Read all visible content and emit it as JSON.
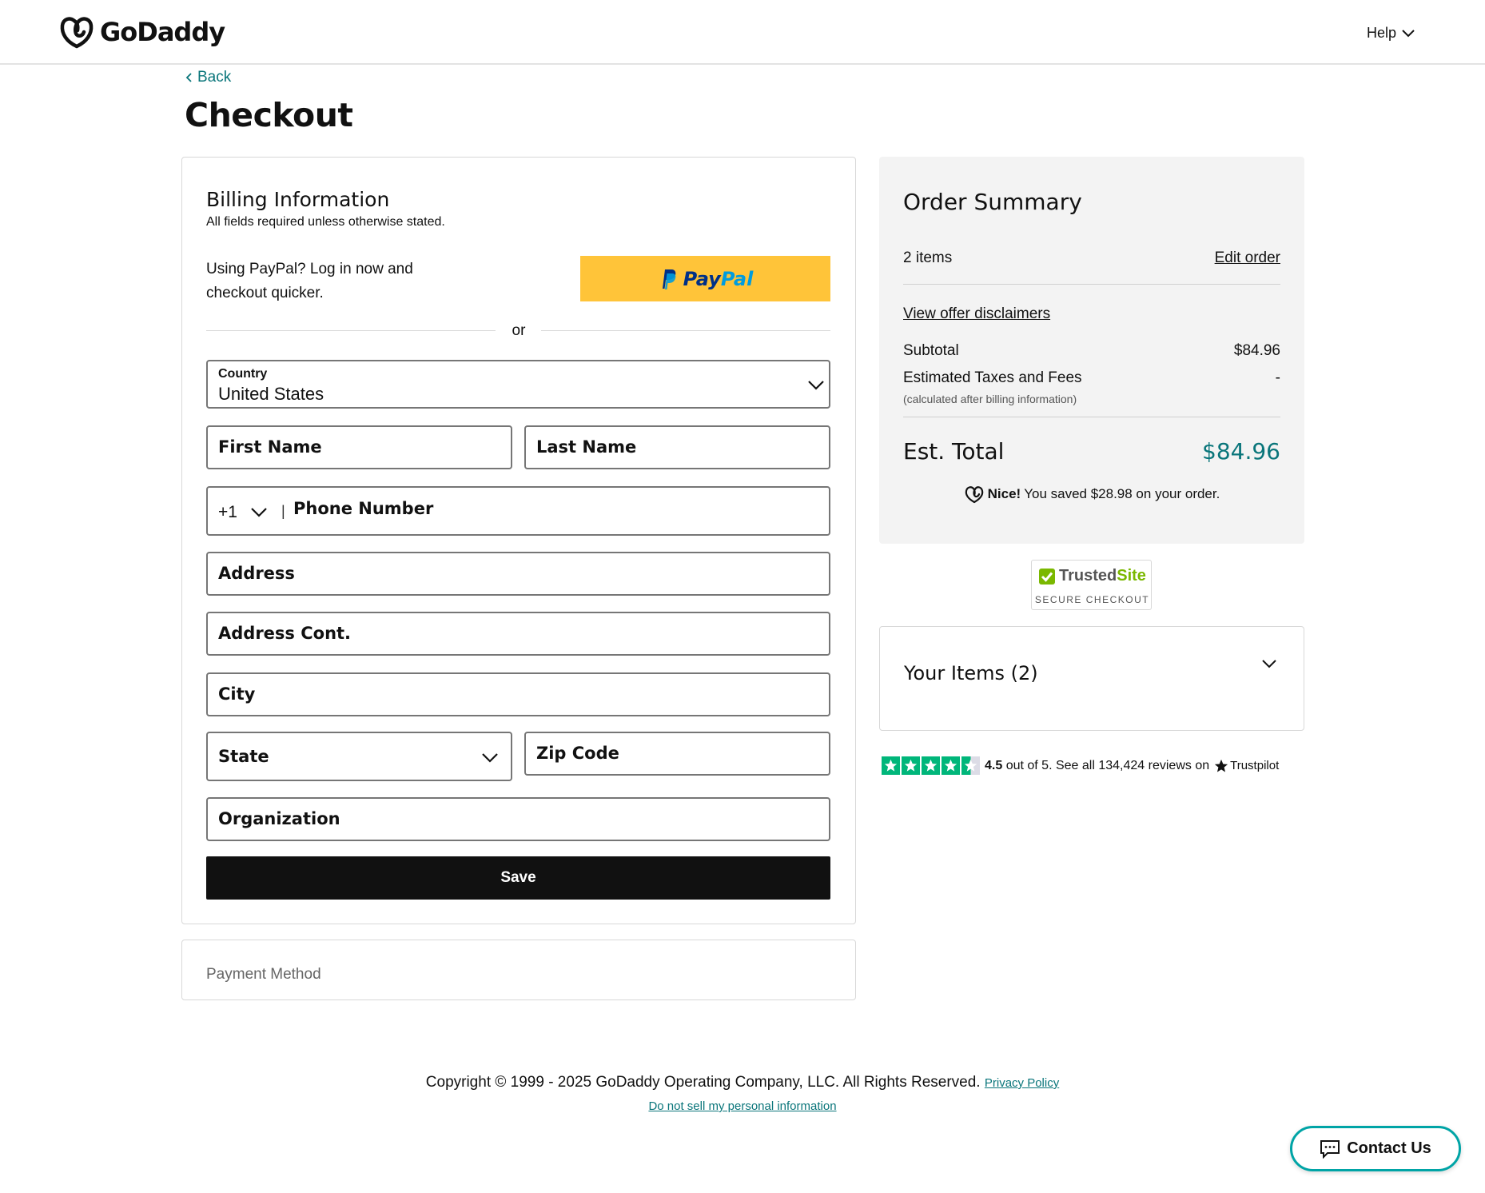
{
  "brand": {
    "name": "GoDaddy",
    "icon": "godaddy-logo-icon"
  },
  "header": {
    "help_label": "Help"
  },
  "nav": {
    "back_label": "Back"
  },
  "page": {
    "title": "Checkout"
  },
  "billing": {
    "title": "Billing Information",
    "subtitle": "All fields required unless otherwise stated.",
    "paypal_prompt": "Using PayPal? Log in now and checkout quicker.",
    "paypal_button": {
      "pay": "Pay",
      "pal": "Pal"
    },
    "or_label": "or",
    "country": {
      "label": "Country",
      "value": "United States"
    },
    "first_name": "First Name",
    "last_name": "Last Name",
    "phone": {
      "country_code": "+1",
      "separator": "|",
      "placeholder": "Phone Number"
    },
    "address": "Address",
    "address_cont": "Address Cont.",
    "city": "City",
    "state": "State",
    "zip": "Zip Code",
    "organization": "Organization",
    "save_label": "Save"
  },
  "payment": {
    "label": "Payment Method"
  },
  "summary": {
    "title": "Order Summary",
    "items_count": "2 items",
    "edit_order": "Edit order",
    "disclaimers": "View offer disclaimers",
    "subtotal_label": "Subtotal",
    "subtotal_value": "$84.96",
    "taxes_label": "Estimated Taxes and Fees",
    "taxes_value": "-",
    "taxes_note": "(calculated after billing information)",
    "total_label": "Est. Total",
    "total_value": "$84.96",
    "savings_bold": "Nice!",
    "savings_text": "You saved $28.98 on your order.",
    "accent_color": "#09757a"
  },
  "trusted_site": {
    "word1": "Trusted",
    "word2": "Site",
    "caption": "SECURE CHECKOUT"
  },
  "your_items": {
    "label": "Your Items (2)"
  },
  "trustpilot": {
    "rating": "4.5",
    "rating_suffix": "out of 5.",
    "reviews_text": "See all 134,424 reviews on",
    "brand": "Trustpilot",
    "stars_filled": 4.5
  },
  "footer": {
    "copyright": "Copyright © 1999 - 2025 GoDaddy Operating Company, LLC. All Rights Reserved.",
    "privacy_link": "Privacy Policy",
    "do_not_sell": "Do not sell my personal information"
  },
  "contact": {
    "label": "Contact Us"
  }
}
